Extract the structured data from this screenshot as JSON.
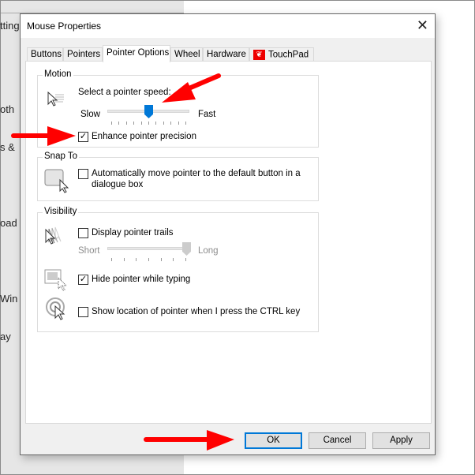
{
  "background_window": {
    "fragments": [
      "tting",
      "oth",
      "s &",
      "oad",
      "Win",
      "ay"
    ]
  },
  "dialog": {
    "title": "Mouse Properties",
    "close_icon": "close-icon",
    "tabs": [
      {
        "label": "Buttons"
      },
      {
        "label": "Pointers"
      },
      {
        "label": "Pointer Options",
        "active": true
      },
      {
        "label": "Wheel"
      },
      {
        "label": "Hardware"
      },
      {
        "label": "TouchPad"
      }
    ],
    "motion": {
      "label": "Motion",
      "speed_label": "Select a pointer speed:",
      "slow": "Slow",
      "fast": "Fast",
      "speed_value_fraction": 0.5,
      "enhance_label": "Enhance pointer precision",
      "enhance_checked": true
    },
    "snap_to": {
      "label": "Snap To",
      "auto_label_line1": "Automatically move pointer to the default button in a",
      "auto_label_line2": "dialogue box",
      "auto_checked": false
    },
    "visibility": {
      "label": "Visibility",
      "trails_label": "Display pointer trails",
      "trails_checked": false,
      "short": "Short",
      "long": "Long",
      "trails_value_fraction": 1.0,
      "hide_label": "Hide pointer while typing",
      "hide_checked": true,
      "ctrl_label": "Show location of pointer when I press the CTRL key",
      "ctrl_checked": false
    },
    "buttons": {
      "ok": "OK",
      "cancel": "Cancel",
      "apply": "Apply"
    }
  },
  "colors": {
    "accent": "#0078d7",
    "annotation_arrow": "#ff0000"
  }
}
